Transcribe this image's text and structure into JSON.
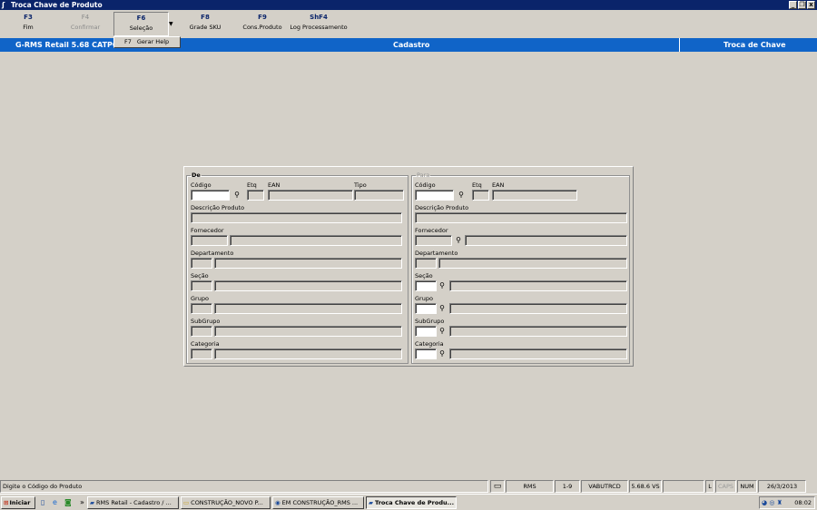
{
  "window": {
    "title": "Troca Chave de Produto",
    "controls": [
      "_",
      "❐",
      "x"
    ]
  },
  "toolbar": {
    "buttons": [
      {
        "key": "F3",
        "label": "Fim"
      },
      {
        "key": "F4",
        "label": "Confirmar"
      },
      {
        "key": "F6",
        "label": "Seleção"
      },
      {
        "key": "F8",
        "label": "Grade SKU"
      },
      {
        "key": "F9",
        "label": "Cons.Produto"
      },
      {
        "key": "ShF4",
        "label": "Log Processamento"
      }
    ],
    "dropdown": {
      "key": "F7",
      "label": "Gerar Help"
    }
  },
  "header": {
    "left": "G-RMS Retail 5.68 CATPC R",
    "center": "Cadastro",
    "right": "Troca de Chave"
  },
  "form": {
    "de": {
      "legend": "De",
      "codigo": "Código",
      "etq": "Etq",
      "ean": "EAN",
      "tipo": "Tipo",
      "descricao": "Descrição Produto",
      "fornecedor": "Fornecedor",
      "departamento": "Departamento",
      "secao": "Seção",
      "grupo": "Grupo",
      "subgrupo": "SubGrupo",
      "categoria": "Categoria"
    },
    "para": {
      "legend": "Para",
      "codigo": "Código",
      "etq": "Etq",
      "ean": "EAN",
      "descricao": "Descrição Produto",
      "fornecedor": "Fornecedor",
      "departamento": "Departamento",
      "secao": "Seção",
      "grupo": "Grupo",
      "subgrupo": "SubGrupo",
      "categoria": "Categoria"
    }
  },
  "statusbar": {
    "message": "Digite o Código do Produto",
    "cells": [
      "RMS",
      "1-9",
      "VABUTRCD",
      "5.68.6 VS",
      "",
      "L",
      "CAPS",
      "NUM",
      "26/3/2013"
    ]
  },
  "taskbar": {
    "start": "Iniciar",
    "chevron": "»",
    "tasks": [
      "RMS Retail - Cadastro / ...",
      "CONSTRUÇÃO_NOVO P...",
      "EM CONSTRUÇÃO_RMS ...",
      "Troca Chave de Produ..."
    ],
    "clock": "08:02"
  }
}
